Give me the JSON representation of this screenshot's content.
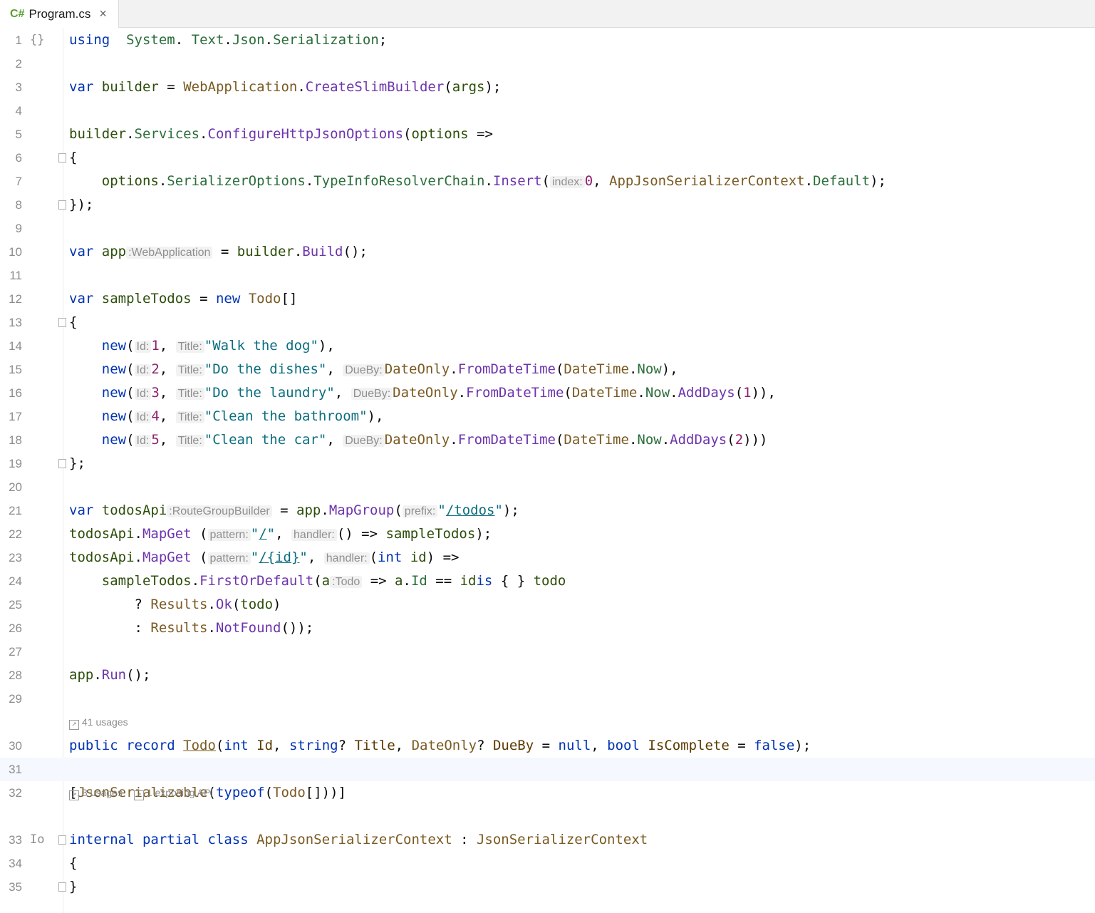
{
  "tab": {
    "lang_icon": "C#",
    "filename": "Program.cs",
    "close_glyph": "×"
  },
  "current_line_number": "31",
  "lens": {
    "todo_usages": "41 usages",
    "context_usages": "3 usages",
    "context_exposing": "1 exposing API"
  },
  "gutter_icons": {
    "line1": "{}",
    "line33": "Io"
  },
  "lines": [
    {
      "n": "1",
      "tokens": [
        [
          "kw",
          "using"
        ],
        [
          "",
          "  "
        ],
        [
          "ns",
          "System"
        ],
        [
          "",
          ". "
        ],
        [
          "ns",
          "Text"
        ],
        [
          "",
          "."
        ],
        [
          "ns",
          "Json"
        ],
        [
          "",
          "."
        ],
        [
          "ns",
          "Serialization"
        ],
        [
          "",
          ";"
        ]
      ]
    },
    {
      "n": "2",
      "tokens": []
    },
    {
      "n": "3",
      "tokens": [
        [
          "kw",
          "var"
        ],
        [
          "",
          " "
        ],
        [
          "va",
          "builder"
        ],
        [
          "",
          " = "
        ],
        [
          "ty",
          "WebApplication"
        ],
        [
          "",
          "."
        ],
        [
          "me",
          "CreateSlimBuilder"
        ],
        [
          "",
          "("
        ],
        [
          "va",
          "args"
        ],
        [
          "",
          ");"
        ]
      ]
    },
    {
      "n": "4",
      "tokens": []
    },
    {
      "n": "5",
      "tokens": [
        [
          "va",
          "builder"
        ],
        [
          "",
          "."
        ],
        [
          "ns",
          "Services"
        ],
        [
          "",
          "."
        ],
        [
          "me",
          "ConfigureHttpJsonOptions"
        ],
        [
          "",
          "("
        ],
        [
          "va",
          "options"
        ],
        [
          "",
          " =>"
        ]
      ]
    },
    {
      "n": "6",
      "tokens": [
        [
          "",
          "{"
        ]
      ]
    },
    {
      "n": "7",
      "tokens": [
        [
          "",
          "    "
        ],
        [
          "va",
          "options"
        ],
        [
          "",
          "."
        ],
        [
          "ns",
          "SerializerOptions"
        ],
        [
          "",
          "."
        ],
        [
          "ns",
          "TypeInfoResolverChain"
        ],
        [
          "",
          "."
        ],
        [
          "me",
          "Insert"
        ],
        [
          "",
          "("
        ],
        [
          "hint",
          "index:"
        ],
        [
          "nu",
          "0"
        ],
        [
          "",
          ", "
        ],
        [
          "ty",
          "AppJsonSerializerContext"
        ],
        [
          "",
          "."
        ],
        [
          "ns",
          "Default"
        ],
        [
          "",
          ");"
        ]
      ]
    },
    {
      "n": "8",
      "tokens": [
        [
          "",
          "});"
        ]
      ]
    },
    {
      "n": "9",
      "tokens": []
    },
    {
      "n": "10",
      "tokens": [
        [
          "kw",
          "var"
        ],
        [
          "",
          " "
        ],
        [
          "va",
          "app"
        ],
        [
          "hint",
          ":WebApplication"
        ],
        [
          "",
          " = "
        ],
        [
          "va",
          "builder"
        ],
        [
          "",
          "."
        ],
        [
          "me",
          "Build"
        ],
        [
          "",
          "();"
        ]
      ]
    },
    {
      "n": "11",
      "tokens": []
    },
    {
      "n": "12",
      "tokens": [
        [
          "kw",
          "var"
        ],
        [
          "",
          " "
        ],
        [
          "va",
          "sampleTodos"
        ],
        [
          "",
          " = "
        ],
        [
          "kw",
          "new"
        ],
        [
          "",
          " "
        ],
        [
          "ty",
          "Todo"
        ],
        [
          "",
          "[]"
        ]
      ]
    },
    {
      "n": "13",
      "tokens": [
        [
          "",
          "{"
        ]
      ]
    },
    {
      "n": "14",
      "tokens": [
        [
          "",
          "    "
        ],
        [
          "kw",
          "new"
        ],
        [
          "",
          "("
        ],
        [
          "hint",
          "Id:"
        ],
        [
          "nu",
          "1"
        ],
        [
          "",
          ", "
        ],
        [
          "hint",
          "Title:"
        ],
        [
          "st",
          "\"Walk the dog\""
        ],
        [
          "",
          "),"
        ]
      ]
    },
    {
      "n": "15",
      "tokens": [
        [
          "",
          "    "
        ],
        [
          "kw",
          "new"
        ],
        [
          "",
          "("
        ],
        [
          "hint",
          "Id:"
        ],
        [
          "nu",
          "2"
        ],
        [
          "",
          ", "
        ],
        [
          "hint",
          "Title:"
        ],
        [
          "st",
          "\"Do the dishes\""
        ],
        [
          "",
          ", "
        ],
        [
          "hint",
          "DueBy:"
        ],
        [
          "ty",
          "DateOnly"
        ],
        [
          "",
          "."
        ],
        [
          "me",
          "FromDateTime"
        ],
        [
          "",
          "("
        ],
        [
          "ty",
          "DateTime"
        ],
        [
          "",
          "."
        ],
        [
          "ns",
          "Now"
        ],
        [
          "",
          "),"
        ]
      ]
    },
    {
      "n": "16",
      "tokens": [
        [
          "",
          "    "
        ],
        [
          "kw",
          "new"
        ],
        [
          "",
          "("
        ],
        [
          "hint",
          "Id:"
        ],
        [
          "nu",
          "3"
        ],
        [
          "",
          ", "
        ],
        [
          "hint",
          "Title:"
        ],
        [
          "st",
          "\"Do the laundry\""
        ],
        [
          "",
          ", "
        ],
        [
          "hint",
          "DueBy:"
        ],
        [
          "ty",
          "DateOnly"
        ],
        [
          "",
          "."
        ],
        [
          "me",
          "FromDateTime"
        ],
        [
          "",
          "("
        ],
        [
          "ty",
          "DateTime"
        ],
        [
          "",
          "."
        ],
        [
          "ns",
          "Now"
        ],
        [
          "",
          "."
        ],
        [
          "me",
          "AddDays"
        ],
        [
          "",
          "("
        ],
        [
          "nu",
          "1"
        ],
        [
          "",
          ")),"
        ]
      ]
    },
    {
      "n": "17",
      "tokens": [
        [
          "",
          "    "
        ],
        [
          "kw",
          "new"
        ],
        [
          "",
          "("
        ],
        [
          "hint",
          "Id:"
        ],
        [
          "nu",
          "4"
        ],
        [
          "",
          ", "
        ],
        [
          "hint",
          "Title:"
        ],
        [
          "st",
          "\"Clean the bathroom\""
        ],
        [
          "",
          "),"
        ]
      ]
    },
    {
      "n": "18",
      "tokens": [
        [
          "",
          "    "
        ],
        [
          "kw",
          "new"
        ],
        [
          "",
          "("
        ],
        [
          "hint",
          "Id:"
        ],
        [
          "nu",
          "5"
        ],
        [
          "",
          ", "
        ],
        [
          "hint",
          "Title:"
        ],
        [
          "st",
          "\"Clean the car\""
        ],
        [
          "",
          ", "
        ],
        [
          "hint",
          "DueBy:"
        ],
        [
          "ty",
          "DateOnly"
        ],
        [
          "",
          "."
        ],
        [
          "me",
          "FromDateTime"
        ],
        [
          "",
          "("
        ],
        [
          "ty",
          "DateTime"
        ],
        [
          "",
          "."
        ],
        [
          "ns",
          "Now"
        ],
        [
          "",
          "."
        ],
        [
          "me",
          "AddDays"
        ],
        [
          "",
          "("
        ],
        [
          "nu",
          "2"
        ],
        [
          "",
          ")))"
        ]
      ]
    },
    {
      "n": "19",
      "tokens": [
        [
          "",
          "};"
        ]
      ]
    },
    {
      "n": "20",
      "tokens": []
    },
    {
      "n": "21",
      "tokens": [
        [
          "kw",
          "var"
        ],
        [
          "",
          " "
        ],
        [
          "va",
          "todosApi"
        ],
        [
          "hint",
          ":RouteGroupBuilder"
        ],
        [
          "",
          " = "
        ],
        [
          "va",
          "app"
        ],
        [
          "",
          "."
        ],
        [
          "me",
          "MapGroup"
        ],
        [
          "",
          "("
        ],
        [
          "hint",
          "prefix:"
        ],
        [
          "st",
          "\""
        ],
        [
          "st ul",
          "/todos"
        ],
        [
          "st",
          "\""
        ],
        [
          "",
          ");"
        ]
      ]
    },
    {
      "n": "22",
      "tokens": [
        [
          "va",
          "todosApi"
        ],
        [
          "",
          "."
        ],
        [
          "me",
          "MapGet"
        ],
        [
          "",
          " ("
        ],
        [
          "hint",
          "pattern:"
        ],
        [
          "st",
          "\""
        ],
        [
          "st ul",
          "/"
        ],
        [
          "st",
          "\""
        ],
        [
          "",
          ", "
        ],
        [
          "hint",
          "handler:"
        ],
        [
          "",
          "() => "
        ],
        [
          "va",
          "sampleTodos"
        ],
        [
          "",
          ");"
        ]
      ]
    },
    {
      "n": "23",
      "tokens": [
        [
          "va",
          "todosApi"
        ],
        [
          "",
          "."
        ],
        [
          "me",
          "MapGet"
        ],
        [
          "",
          " ("
        ],
        [
          "hint",
          "pattern:"
        ],
        [
          "st",
          "\""
        ],
        [
          "st ul",
          "/{id}"
        ],
        [
          "st",
          "\""
        ],
        [
          "",
          ", "
        ],
        [
          "hint",
          "handler:"
        ],
        [
          "",
          "("
        ],
        [
          "kw",
          "int"
        ],
        [
          "",
          " "
        ],
        [
          "va",
          "id"
        ],
        [
          "",
          ") =>"
        ]
      ]
    },
    {
      "n": "24",
      "tokens": [
        [
          "",
          "    "
        ],
        [
          "va",
          "sampleTodos"
        ],
        [
          "",
          "."
        ],
        [
          "me",
          "FirstOrDefault"
        ],
        [
          "",
          "("
        ],
        [
          "va",
          "a"
        ],
        [
          "hint",
          ":Todo"
        ],
        [
          "",
          " => "
        ],
        [
          "va",
          "a"
        ],
        [
          "",
          "."
        ],
        [
          "ns",
          "Id"
        ],
        [
          "",
          " == "
        ],
        [
          "va",
          "id"
        ],
        [
          ") "
        ],
        [
          "kw",
          "is"
        ],
        [
          "",
          " { } "
        ],
        [
          "va",
          "todo"
        ]
      ]
    },
    {
      "n": "25",
      "tokens": [
        [
          "",
          "        ? "
        ],
        [
          "ty",
          "Results"
        ],
        [
          "",
          "."
        ],
        [
          "me",
          "Ok"
        ],
        [
          "",
          "("
        ],
        [
          "va",
          "todo"
        ],
        [
          "",
          ")"
        ]
      ]
    },
    {
      "n": "26",
      "tokens": [
        [
          "",
          "        : "
        ],
        [
          "ty",
          "Results"
        ],
        [
          "",
          "."
        ],
        [
          "me",
          "NotFound"
        ],
        [
          "",
          "());"
        ]
      ]
    },
    {
      "n": "27",
      "tokens": []
    },
    {
      "n": "28",
      "tokens": [
        [
          "va",
          "app"
        ],
        [
          "",
          "."
        ],
        [
          "me",
          "Run"
        ],
        [
          "",
          "();"
        ]
      ]
    },
    {
      "n": "29",
      "tokens": []
    },
    {
      "n": "30",
      "tokens": [
        [
          "kw",
          "public record "
        ],
        [
          "ty ul",
          "Todo"
        ],
        [
          "",
          "("
        ],
        [
          "kw",
          "int"
        ],
        [
          "",
          " "
        ],
        [
          "pr",
          "Id"
        ],
        [
          "",
          ", "
        ],
        [
          "kw",
          "string"
        ],
        [
          "",
          "? "
        ],
        [
          "pr",
          "Title"
        ],
        [
          "",
          ", "
        ],
        [
          "ty",
          "DateOnly"
        ],
        [
          "",
          "? "
        ],
        [
          "pr",
          "DueBy"
        ],
        [
          "",
          " = "
        ],
        [
          "kw",
          "null"
        ],
        [
          "",
          ", "
        ],
        [
          "kw",
          "bool"
        ],
        [
          "",
          " "
        ],
        [
          "pr",
          "IsComplete"
        ],
        [
          "",
          " = "
        ],
        [
          "kw",
          "false"
        ],
        [
          "",
          ");"
        ]
      ]
    },
    {
      "n": "31",
      "tokens": []
    },
    {
      "n": "32",
      "tokens": [
        [
          "",
          "["
        ],
        [
          "ty",
          "JsonSerializable"
        ],
        [
          "",
          "("
        ],
        [
          "kw",
          "typeof"
        ],
        [
          "",
          "("
        ],
        [
          "ty",
          "Todo"
        ],
        [
          "",
          "[]))]"
        ]
      ]
    },
    {
      "n": "33",
      "tokens": [
        [
          "kw",
          "internal partial class "
        ],
        [
          "ty",
          "AppJsonSerializerContext"
        ],
        [
          "",
          " : "
        ],
        [
          "ty",
          "JsonSerializerContext"
        ]
      ]
    },
    {
      "n": "34",
      "tokens": [
        [
          "",
          "{"
        ]
      ]
    },
    {
      "n": "35",
      "tokens": [
        [
          "",
          "}"
        ]
      ]
    }
  ]
}
